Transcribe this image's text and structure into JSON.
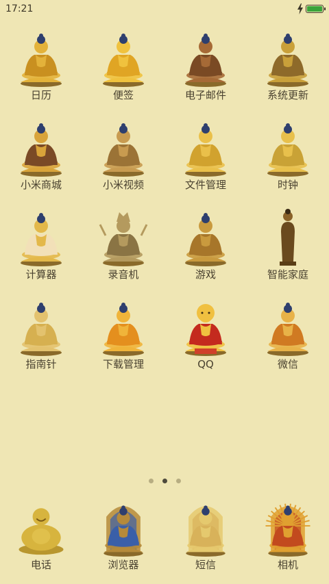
{
  "status_bar": {
    "time": "17:21",
    "battery_level": 1.0,
    "charging": true,
    "battery_color": "#3aa43a"
  },
  "home_apps": [
    {
      "label": "日历",
      "icon": "buddha-statue-icon",
      "tone": "#E3B23A",
      "robe": "#C99020"
    },
    {
      "label": "便签",
      "icon": "buddha-statue-icon",
      "tone": "#F0C23E",
      "robe": "#E0A524"
    },
    {
      "label": "电子邮件",
      "icon": "buddha-statue-icon",
      "tone": "#A66A36",
      "robe": "#7A4A24"
    },
    {
      "label": "系统更新",
      "icon": "buddha-statue-icon",
      "tone": "#C9A03A",
      "robe": "#8E6A2A"
    },
    {
      "label": "小米商城",
      "icon": "buddha-statue-icon",
      "tone": "#D9A43A",
      "robe": "#7A4A26"
    },
    {
      "label": "小米视频",
      "icon": "buddha-statue-icon",
      "tone": "#C89B50",
      "robe": "#9B7336"
    },
    {
      "label": "文件管理",
      "icon": "buddha-statue-icon",
      "tone": "#EAC04A",
      "robe": "#D1A22E"
    },
    {
      "label": "时钟",
      "icon": "buddha-statue-icon",
      "tone": "#E8C04C",
      "robe": "#C9A236"
    },
    {
      "label": "计算器",
      "icon": "buddha-statue-icon",
      "tone": "#E3B84A",
      "robe": "#F2E0B8"
    },
    {
      "label": "录音机",
      "icon": "bodhisattva-statue-icon",
      "tone": "#B49A5E",
      "robe": "#8A7444"
    },
    {
      "label": "游戏",
      "icon": "buddha-statue-icon",
      "tone": "#C99A3E",
      "robe": "#A7762A"
    },
    {
      "label": "智能家庭",
      "icon": "standing-buddha-icon",
      "tone": "#8A6228",
      "robe": "#6A4A1E"
    },
    {
      "label": "指南针",
      "icon": "buddha-statue-icon",
      "tone": "#E3C26E",
      "robe": "#D6B050"
    },
    {
      "label": "下载管理",
      "icon": "buddha-statue-icon",
      "tone": "#F0B43A",
      "robe": "#E48F1E"
    },
    {
      "label": "QQ",
      "icon": "bald-monk-statue-icon",
      "tone": "#F0C040",
      "robe": "#C42A1E"
    },
    {
      "label": "微信",
      "icon": "buddha-statue-icon",
      "tone": "#E8B248",
      "robe": "#D07A22"
    }
  ],
  "page_indicator": {
    "count": 3,
    "active": 1
  },
  "dock_apps": [
    {
      "label": "电话",
      "icon": "laughing-buddha-icon",
      "tone": "#D7B43E",
      "robe": "#E0C04C"
    },
    {
      "label": "浏览器",
      "icon": "shrine-statue-icon",
      "tone": "#B58A3A",
      "robe": "#3A5FA8"
    },
    {
      "label": "短信",
      "icon": "shrine-statue-icon",
      "tone": "#E5C96E",
      "robe": "#D8B25A"
    },
    {
      "label": "相机",
      "icon": "thousand-arm-guanyin-icon",
      "tone": "#E0A030",
      "robe": "#C24A1E"
    }
  ]
}
